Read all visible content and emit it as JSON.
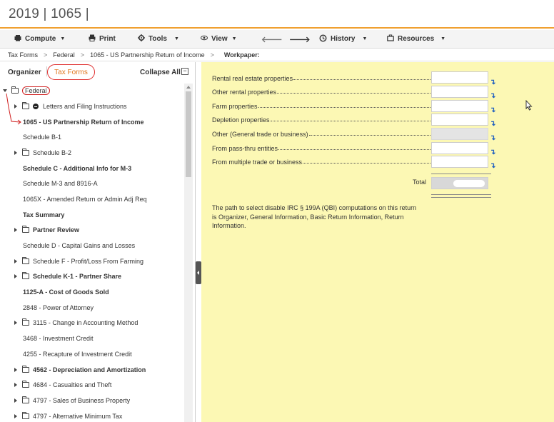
{
  "window": {
    "title": "2019 | 1065 |"
  },
  "toolbar": {
    "compute": "Compute",
    "print": "Print",
    "tools": "Tools",
    "view": "View",
    "history": "History",
    "resources": "Resources"
  },
  "breadcrumb": {
    "items": [
      "Tax Forms",
      "Federal",
      "1065 - US Partnership Return of Income"
    ],
    "workpaper": "Workpaper:"
  },
  "left_panel": {
    "tab_organizer": "Organizer",
    "tab_tax_forms": "Tax Forms",
    "collapse_all": "Collapse All",
    "collapse_symbol": "−",
    "tree": [
      {
        "label": "Federal"
      },
      {
        "label": "Letters and Filing Instructions"
      },
      {
        "label": "1065 - US Partnership Return of Income"
      },
      {
        "label": "Schedule B-1"
      },
      {
        "label": "Schedule B-2"
      },
      {
        "label": "Schedule C - Additional Info for M-3"
      },
      {
        "label": "Schedule M-3 and 8916-A"
      },
      {
        "label": "1065X - Amended Return or Admin Adj Req"
      },
      {
        "label": "Tax Summary"
      },
      {
        "label": "Partner Review"
      },
      {
        "label": "Schedule D - Capital Gains and Losses"
      },
      {
        "label": "Schedule F - Profit/Loss From Farming"
      },
      {
        "label": "Schedule K-1 - Partner Share"
      },
      {
        "label": "1125-A - Cost of Goods Sold"
      },
      {
        "label": "2848 - Power of Attorney"
      },
      {
        "label": "3115 - Change in Accounting Method"
      },
      {
        "label": "3468 - Investment Credit"
      },
      {
        "label": "4255 - Recapture of Investment Credit"
      },
      {
        "label": "4562 - Depreciation and Amortization"
      },
      {
        "label": "4684 - Casualties and Theft"
      },
      {
        "label": "4797 - Sales of Business Property"
      },
      {
        "label": "4797 - Alternative Minimum Tax"
      }
    ]
  },
  "form": {
    "rows": [
      {
        "label": "Rental real estate properties"
      },
      {
        "label": "Other rental properties"
      },
      {
        "label": "Farm properties"
      },
      {
        "label": "Depletion properties"
      },
      {
        "label": "Other (General trade or business)"
      },
      {
        "label": "From pass-thru entities"
      },
      {
        "label": "From multiple trade or business"
      }
    ],
    "total_label": "Total",
    "note": "The path to select disable IRC § 199A (QBI) computations on this return is Organizer, General Information, Basic Return Information, Return Information."
  },
  "colors": {
    "accent": "#f0a030",
    "form_background": "#fcf8b4",
    "annotation_red": "#d02020",
    "tax_forms_orange": "#e07820",
    "link_blue": "#2060c0"
  },
  "icons": {
    "compute": "calculator-icon",
    "print": "printer-icon",
    "tools": "gear-icon",
    "view": "eye-icon",
    "back": "arrow-left-icon",
    "forward": "arrow-right-icon",
    "history": "history-icon",
    "resources": "briefcase-icon"
  }
}
